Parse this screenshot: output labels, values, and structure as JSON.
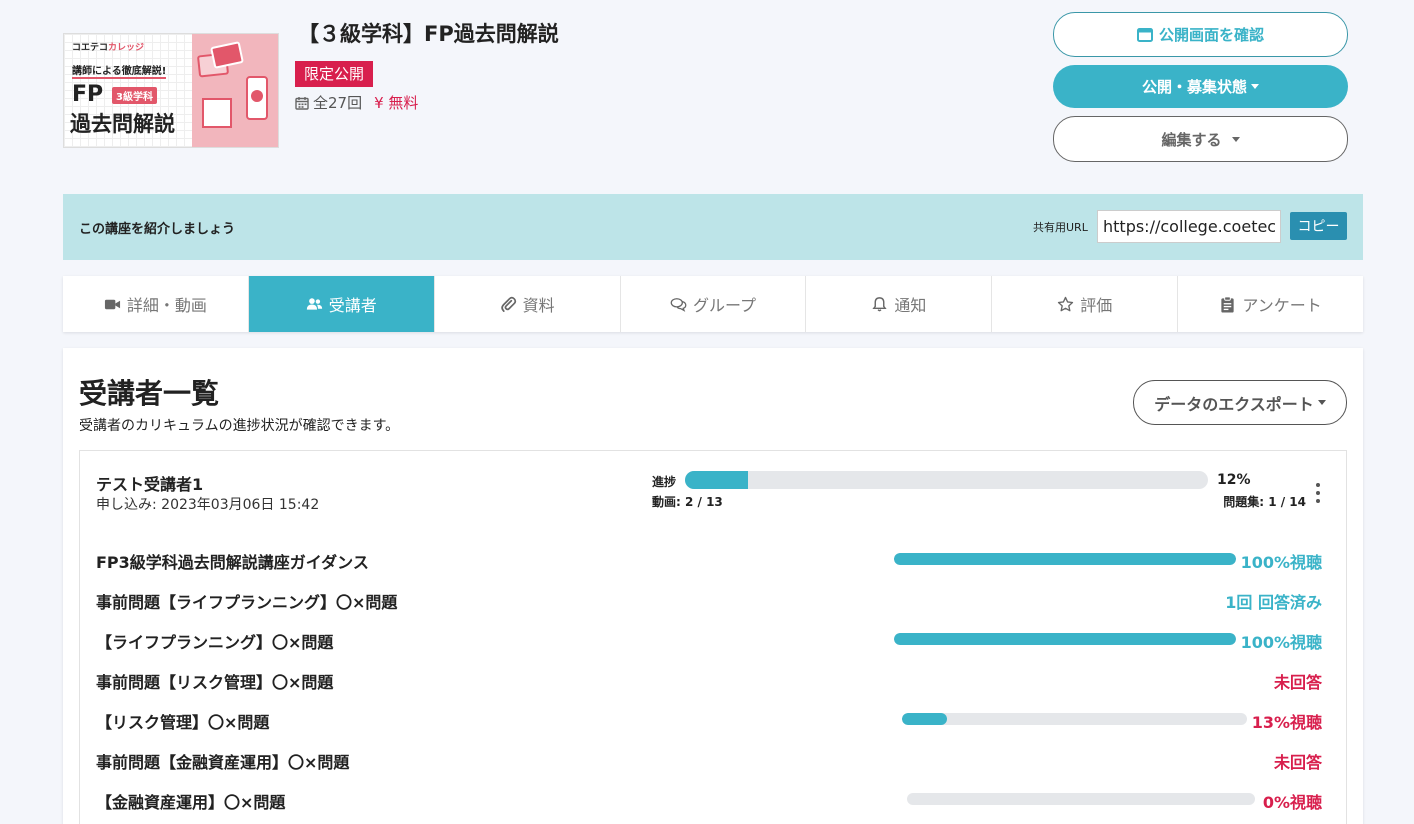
{
  "course": {
    "thumbnail": {
      "brand": "コエテコ",
      "brand_accent": "カレッジ",
      "subtitle": "講師による徹底解説!",
      "fp": "FP",
      "badge": "3級学科",
      "title": "過去問解説"
    },
    "title": "【３級学科】FP過去問解説",
    "visibility_badge": "限定公開",
    "episodes": "全27回",
    "price": "¥ 無料"
  },
  "actions": {
    "preview": "公開画面を確認",
    "status": "公開・募集状態",
    "edit": "編集する"
  },
  "share": {
    "text": "この講座を紹介しましょう",
    "label": "共有用URL",
    "url": "https://college.coeteco.jp",
    "copy": "コピー"
  },
  "tabs": [
    {
      "label": "詳細・動画",
      "icon": "video-camera-icon"
    },
    {
      "label": "受講者",
      "icon": "users-icon",
      "active": true
    },
    {
      "label": "資料",
      "icon": "paperclip-icon"
    },
    {
      "label": "グループ",
      "icon": "chat-bubbles-icon"
    },
    {
      "label": "通知",
      "icon": "bell-icon"
    },
    {
      "label": "評価",
      "icon": "star-icon"
    },
    {
      "label": "アンケート",
      "icon": "clipboard-icon"
    }
  ],
  "panel": {
    "title": "受講者一覧",
    "description": "受講者のカリキュラムの進捗状況が確認できます。",
    "export": "データのエクスポート"
  },
  "student": {
    "name": "テスト受講者1",
    "applied": "申し込み: 2023年03月06日 15:42",
    "progress_label": "進捗",
    "progress": 0.12,
    "progress_text": "12%",
    "videos": "動画: 2 / 13",
    "problems": "問題集: 1 / 14"
  },
  "curriculum": [
    {
      "title": "FP3級学科過去問解説講座ガイダンス",
      "status": "100%視聴",
      "kind": "ok",
      "progress": 1.0
    },
    {
      "title": "事前問題【ライフプランニング】〇×問題",
      "status": "1回 回答済み",
      "kind": "ok"
    },
    {
      "title": "【ライフプランニング】〇×問題",
      "status": "100%視聴",
      "kind": "ok",
      "progress": 1.0
    },
    {
      "title": "事前問題【リスク管理】〇×問題",
      "status": "未回答",
      "kind": "ng"
    },
    {
      "title": "【リスク管理】〇×問題",
      "status": "13%視聴",
      "kind": "ng",
      "progress": 0.13
    },
    {
      "title": "事前問題【金融資産運用】〇×問題",
      "status": "未回答",
      "kind": "ng"
    },
    {
      "title": "【金融資産運用】〇×問題",
      "status": "0%視聴",
      "kind": "ng",
      "progress": 0.0
    }
  ],
  "colors": {
    "accent": "#3ab3c8",
    "danger": "#d81f4d",
    "share_bg": "#bde4e8"
  }
}
